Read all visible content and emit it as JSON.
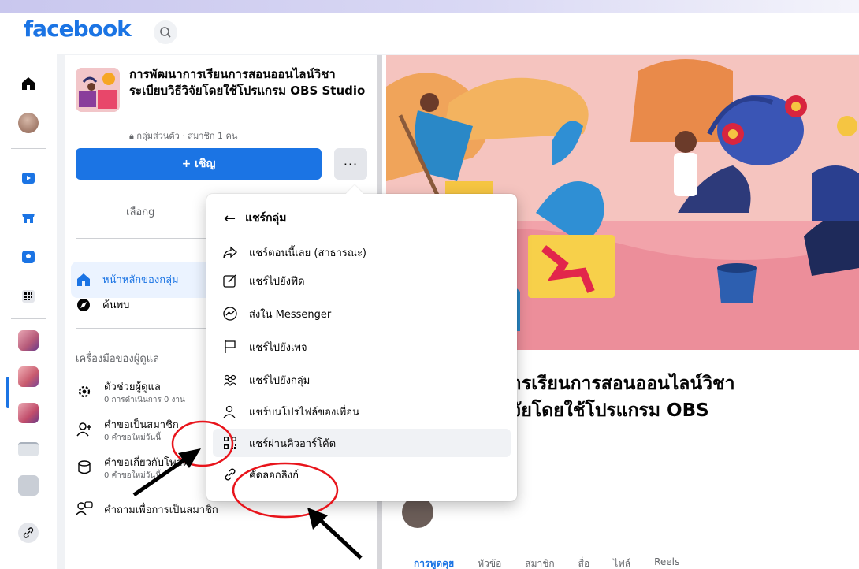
{
  "header": {
    "logo": "facebook"
  },
  "group": {
    "name": "การพัฒนาการเรียนการสอนออนไลน์วิชาระเบียบวิธีวิจัยโดยใช้โปรแกรม OBS Studio",
    "meta": "กลุ่มส่วนตัว · สมาชิก 1 คน",
    "invite_label": "+ เชิญ",
    "more_label": "···",
    "tab_label": "เลือกg"
  },
  "sidebar": {
    "items": [
      {
        "label": "หน้าหลักของกลุ่ม"
      },
      {
        "label": "ค้นพบ"
      }
    ],
    "tools_title": "เครื่องมือของผู้ดูแล",
    "tools": [
      {
        "title": "ตัวช่วยผู้ดูแล",
        "sub": "0 การดำเนินการ 0 งาน"
      },
      {
        "title": "คำขอเป็นสมาชิก",
        "sub": "0 คำขอใหม่วันนี้"
      },
      {
        "title": "คำขอเกี่ยวกับโพสต์",
        "sub": "0 คำขอใหม่วันนี้"
      },
      {
        "title": "คำถามเพื่อการเป็นสมาชิก",
        "sub": ""
      }
    ]
  },
  "share_menu": {
    "title": "แชร์กลุ่ม",
    "items": [
      {
        "label": "แชร์ตอนนี้เลย (สาธารณะ)",
        "icon": "share-arrow-icon"
      },
      {
        "label": "แชร์ไปยังฟีด",
        "icon": "compose-icon"
      },
      {
        "label": "ส่งใน Messenger",
        "icon": "messenger-icon"
      },
      {
        "label": "แชร์ไปยังเพจ",
        "icon": "flag-icon"
      },
      {
        "label": "แชร์ไปยังกลุ่ม",
        "icon": "group-icon"
      },
      {
        "label": "แชร์บนโปรไฟล์ของเพื่อน",
        "icon": "friend-profile-icon"
      },
      {
        "label": "แชร์ผ่านคิวอาร์โค้ด",
        "icon": "qr-code-icon"
      },
      {
        "label": "คัดลอกลิงก์",
        "icon": "link-icon"
      }
    ]
  },
  "main": {
    "title_line1": "การเรียนการสอนออนไลน์วิชา",
    "title_line2": "วิจัยโดยใช้โปรแกรม OBS",
    "tabs": [
      "การพูดคุย",
      "หัวข้อ",
      "สมาชิก",
      "สื่อ",
      "ไฟล์",
      "Reels"
    ]
  },
  "colors": {
    "brand": "#1b74e4",
    "annotation_circle": "#e8141b",
    "annotation_arrow": "#000000"
  }
}
